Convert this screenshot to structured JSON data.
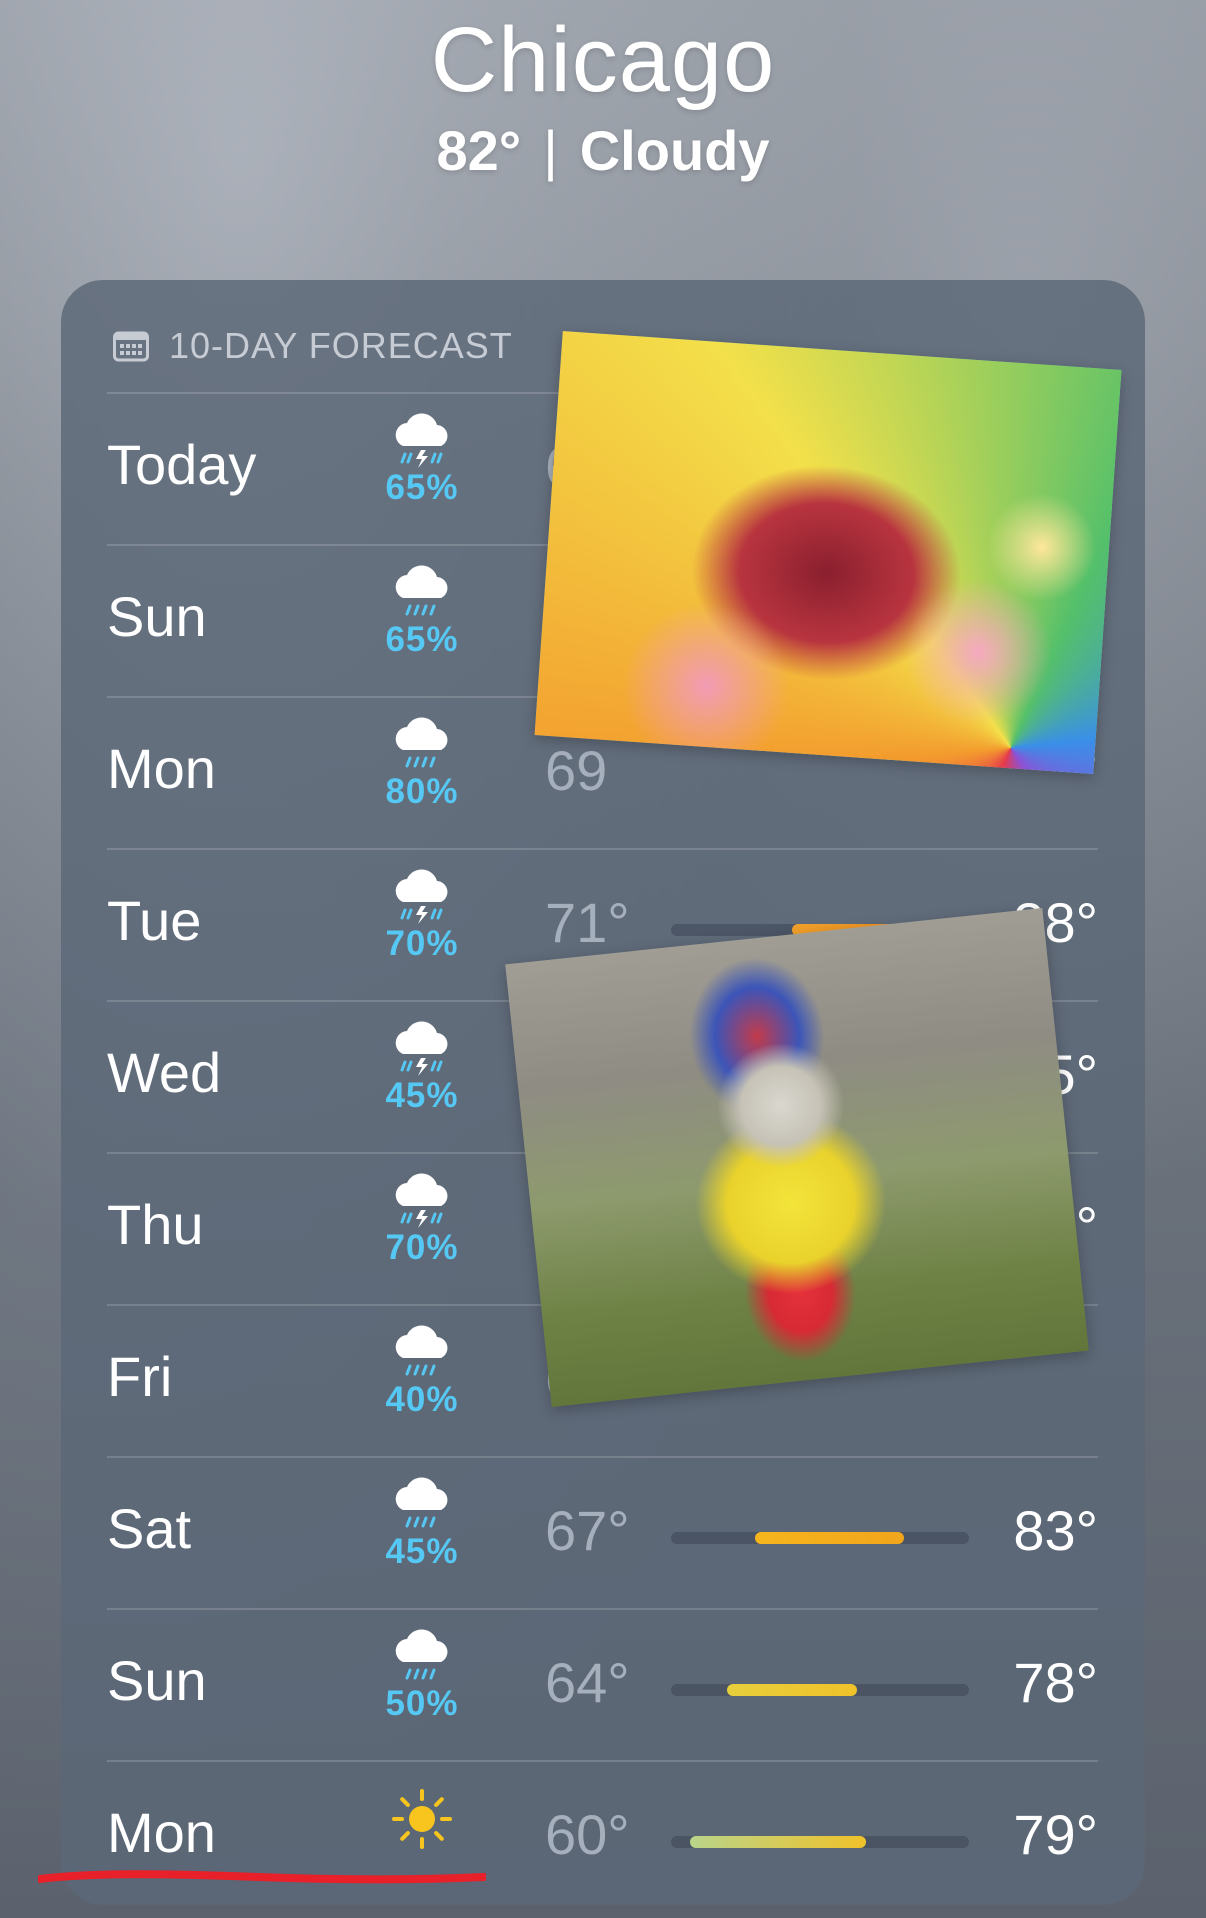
{
  "location": {
    "city": "Chicago",
    "temperature": "82°",
    "separator": "|",
    "condition": "Cloudy"
  },
  "forecast": {
    "header_icon": "calendar-icon",
    "title": "10-DAY FORECAST",
    "days": [
      {
        "day": "Today",
        "icon": "thunderstorm-icon",
        "precip": "65%",
        "low": "6",
        "high": ""
      },
      {
        "day": "Sun",
        "icon": "rain-icon",
        "precip": "65%",
        "low": "",
        "high": ""
      },
      {
        "day": "Mon",
        "icon": "rain-icon",
        "precip": "80%",
        "low": "69",
        "high": "°"
      },
      {
        "day": "Tue",
        "icon": "thunderstorm-icon",
        "precip": "70%",
        "low": "71°",
        "high": "38°"
      },
      {
        "day": "Wed",
        "icon": "thunderstorm-icon",
        "precip": "45%",
        "low": "",
        "high": "5°"
      },
      {
        "day": "Thu",
        "icon": "thunderstorm-icon",
        "precip": "70%",
        "low": "",
        "high": "°"
      },
      {
        "day": "Fri",
        "icon": "rain-icon",
        "precip": "40%",
        "low": "6",
        "high": ""
      },
      {
        "day": "Sat",
        "icon": "rain-icon",
        "precip": "45%",
        "low": "67°",
        "high": "83°"
      },
      {
        "day": "Sun",
        "icon": "rain-icon",
        "precip": "50%",
        "low": "64°",
        "high": "78°"
      },
      {
        "day": "Mon",
        "icon": "sun-icon",
        "precip": "",
        "low": "60°",
        "high": "79°"
      }
    ]
  },
  "range_bars": {
    "scale_min": 58,
    "scale_max": 90,
    "colors": {
      "warm": "#f5a31a",
      "hot": "#f28b1e",
      "mild": "#e7cf3c",
      "cool": "#b9d48a",
      "track": "#3f4b5a"
    },
    "rows": [
      {
        "day_index": 3,
        "low": 71,
        "high": 88,
        "from_color": "#f3a12b",
        "to_color": "#f28b1e"
      },
      {
        "day_index": 7,
        "low": 67,
        "high": 83,
        "from_color": "#f6b51d",
        "to_color": "#f2a51b"
      },
      {
        "day_index": 8,
        "low": 64,
        "high": 78,
        "from_color": "#e7cf3c",
        "to_color": "#f0c22a"
      },
      {
        "day_index": 9,
        "low": 60,
        "high": 79,
        "from_color": "#b9d48a",
        "to_color": "#f0c22a"
      }
    ]
  },
  "stickers": {
    "first_icon": "dolphin-rainbow-sticker-icon",
    "second_icon": "dog-costume-sticker-icon"
  },
  "annotation": {
    "underline_color": "#e8202a"
  }
}
